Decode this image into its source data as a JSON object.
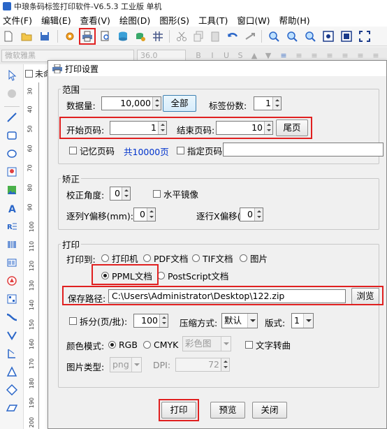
{
  "app": {
    "title": "中琅条码标签打印软件-V6.5.3 工业版 单机",
    "menu": [
      "文件(F)",
      "编辑(E)",
      "查看(V)",
      "绘图(D)",
      "图形(S)",
      "工具(T)",
      "窗口(W)",
      "帮助(H)"
    ],
    "font_name": "微软雅黑",
    "font_size": "36.0",
    "doc_tab": "未命"
  },
  "ruler_numbers": [
    "30",
    "40",
    "50",
    "60",
    "70",
    "80",
    "90",
    "100",
    "110",
    "120",
    "130",
    "140",
    "150",
    "160",
    "170",
    "180",
    "190",
    "200"
  ],
  "dialog": {
    "title": "打印设置",
    "range": {
      "legend": "范围",
      "data_count_label": "数据量:",
      "data_count": "10,000",
      "all_button": "全部",
      "copies_label": "标签份数:",
      "copies": "1",
      "start_page_label": "开始页码:",
      "start_page": "1",
      "end_page_label": "结束页码:",
      "end_page": "10",
      "last_page_button": "尾页",
      "remember_label": "记忆页码",
      "total_pages": "共10000页",
      "specify_label": "指定页码",
      "specify_value": ""
    },
    "correction": {
      "legend": "矫正",
      "angle_label": "校正角度:",
      "angle": "0",
      "mirror_label": "水平镜像",
      "col_offset_label": "逐列Y偏移(mm):",
      "col_offset": "0",
      "row_offset_label": "逐行X偏移(mm):",
      "row_offset": "0"
    },
    "print": {
      "legend": "打印",
      "target_label": "打印到:",
      "targets": [
        "打印机",
        "PDF文档",
        "TIF文档",
        "图片",
        "PPML文档",
        "PostScript文档"
      ],
      "selected_target": "PPML文档",
      "path_label": "保存路径:",
      "path": "C:\\Users\\Administrator\\Desktop\\122.zip",
      "browse_button": "浏览",
      "split_label": "拆分(页/批):",
      "split_value": "100",
      "compress_label": "压缩方式:",
      "compress_value": "默认",
      "layout_label": "版式:",
      "layout_value": "1",
      "color_mode_label": "颜色模式:",
      "color_rgb": "RGB",
      "color_cmyk": "CMYK",
      "color_combo": "彩色图",
      "text_convert_label": "文字转曲",
      "image_type_label": "图片类型:",
      "image_type": "png",
      "dpi_label": "DPI:",
      "dpi": "72"
    },
    "buttons": {
      "print": "打印",
      "preview": "预览",
      "close": "关闭"
    }
  }
}
